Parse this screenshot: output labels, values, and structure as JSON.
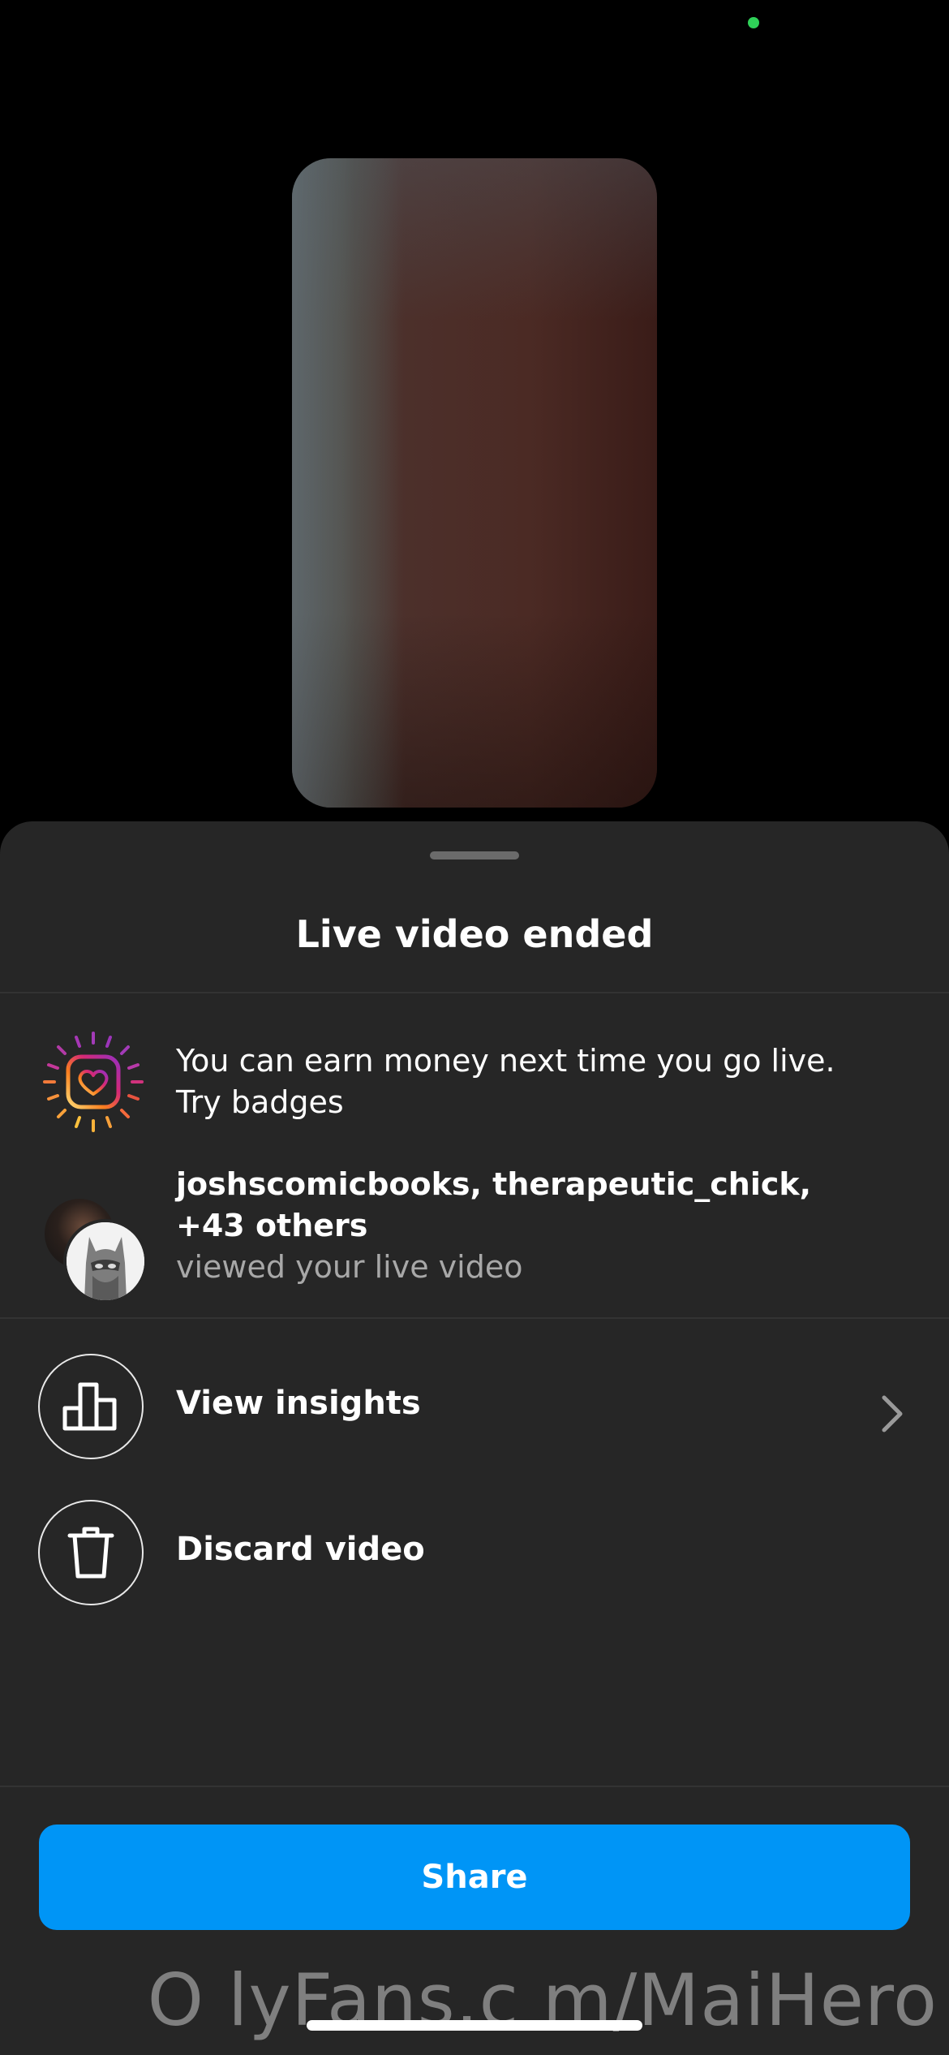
{
  "status": {
    "indicator_color": "#2fd158"
  },
  "sheet": {
    "title": "Live video ended",
    "promo": {
      "icon": "instagram-heart-badge-icon",
      "line1": "You can earn money next time you go live.",
      "line2": "Try badges"
    },
    "viewers": {
      "names_line1": "joshscomicbooks, therapeutic_chick,",
      "names_line2": "+43 others",
      "subtitle": "viewed your live video"
    },
    "actions": [
      {
        "icon": "bar-chart-icon",
        "label": "View insights",
        "trailing_icon": "chevron-right-icon"
      },
      {
        "icon": "trash-icon",
        "label": "Discard video"
      }
    ],
    "share_label": "Share"
  },
  "watermark": "O lyFans.c m/MaiHero",
  "colors": {
    "background": "#000000",
    "sheet": "#262626",
    "accent": "#0095f6",
    "secondary_text": "#a8a8a8"
  }
}
